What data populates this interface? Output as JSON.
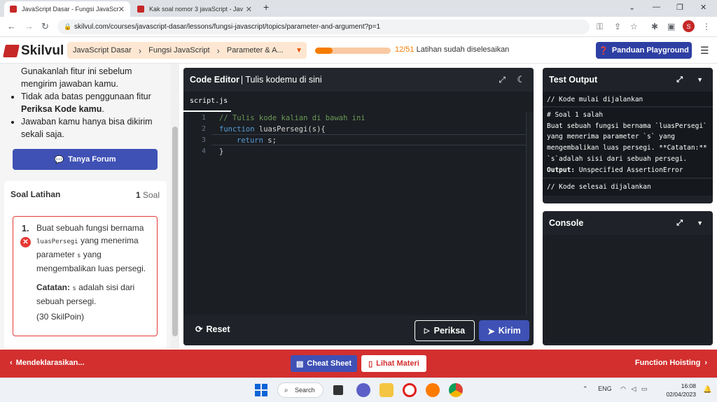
{
  "browser": {
    "tabs": [
      {
        "title": "JavaScript Dasar - Fungsi JavaScr",
        "active": true
      },
      {
        "title": "Kak soal nomor 3 javaScript - Jav",
        "active": false
      }
    ],
    "url": "skilvul.com/courses/javascript-dasar/lessons/fungsi-javascript/topics/parameter-and-argument?p=1",
    "profile_initial": "S"
  },
  "header": {
    "logo_text": "Skilvul",
    "breadcrumbs": [
      "JavaScript Dasar",
      "Fungsi JavaScript",
      "Parameter & A..."
    ],
    "progress_count": "12/51",
    "progress_fraction": 0.235,
    "progress_label": "Latihan sudah diselesaikan",
    "panduan_label": "Panduan Playground"
  },
  "left": {
    "intro_first": "Gunakanlah fitur ini sebelum mengirim jawaban kamu.",
    "bullet2_pre": "Tidak ada batas penggunaan fitur ",
    "bullet2_bold": "Periksa Kode kamu",
    "bullet2_post": ".",
    "bullet3": "Jawaban kamu hanya bisa dikirim sekali saja.",
    "forum_label": "Tanya Forum",
    "soal_title": "Soal Latihan",
    "soal_count": "1",
    "soal_count_unit": "Soal",
    "question": {
      "number": "1.",
      "text_pre": "Buat sebuah fungsi bernama ",
      "code_name": "luasPersegi",
      "text_mid": " yang menerima parameter ",
      "code_param": "s",
      "text_post": " yang mengembalikan luas persegi.",
      "note_label": "Catatan:",
      "note_code": "s",
      "note_text": " adalah sisi dari sebuah persegi.",
      "points": "(30 SkilPoin)"
    }
  },
  "editor": {
    "title_bold": "Code Editor",
    "title_rest": "| Tulis kodemu di sini",
    "file_tab": "script.js",
    "lines": [
      {
        "no": "1",
        "comment": "// Tulis kode kalian di bawah ini"
      },
      {
        "no": "2",
        "keyword": "function",
        "rest": " luasPersegi(s){"
      },
      {
        "no": "3",
        "keyword": "return",
        "rest": " s;"
      },
      {
        "no": "4",
        "rest": "}"
      }
    ],
    "reset_label": "Reset",
    "periksa_label": "Periksa",
    "kirim_label": "Kirim"
  },
  "test_output": {
    "title": "Test Output",
    "start": "// Kode mulai dijalankan",
    "result_lines": [
      "# Soal 1 salah",
      "Buat sebuah fungsi bernama `luasPersegi`",
      "yang menerima parameter `s` yang",
      "mengembalikan luas persegi. **Catatan:**",
      "`s`adalah sisi dari sebuah persegi."
    ],
    "output_label": "Output:",
    "output_value": " Unspecified AssertionError",
    "end": "// Kode selesai dijalankan"
  },
  "console": {
    "title": "Console"
  },
  "bottom": {
    "prev_label": "Mendeklarasikan...",
    "cheat_label": "Cheat Sheet",
    "lihat_label": "Lihat Materi",
    "next_label": "Function Hoisting"
  },
  "taskbar": {
    "search_label": "Search",
    "language": "ENG",
    "time": "16:08",
    "date": "02/04/2023"
  },
  "colors": {
    "brand_red": "#d32f2f",
    "accent_blue": "#3f51b5",
    "progress_orange": "#f57c00"
  }
}
